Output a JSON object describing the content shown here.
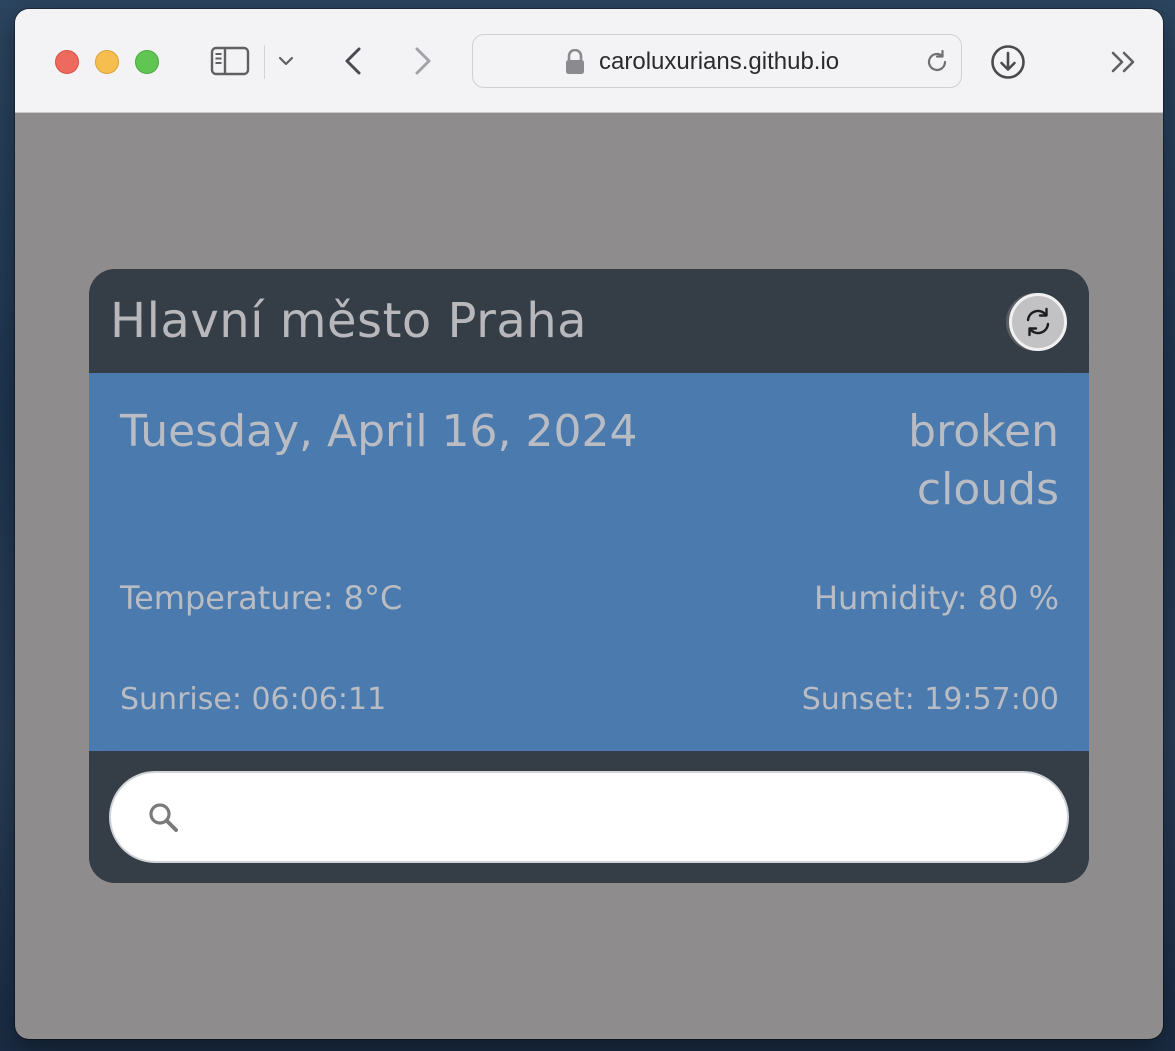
{
  "browser": {
    "url": "caroluxurians.github.io"
  },
  "weather": {
    "city": "Hlavní město Praha",
    "date": "Tuesday, April 16, 2024",
    "description": "broken clouds",
    "temperature": "Temperature: 8°C",
    "humidity": "Humidity: 80 %",
    "sunrise": "Sunrise: 06:06:11",
    "sunset": "Sunset: 19:57:00"
  },
  "search": {
    "value": "",
    "placeholder": ""
  },
  "colors": {
    "page_bg": "#8e8c8d",
    "card_dark": "#353d47",
    "card_body": "#4a7aae",
    "text": "#b9bcc3"
  },
  "icons": {
    "sidebar": "sidebar-icon",
    "refresh": "refresh-icon",
    "search": "search-icon",
    "download": "download-icon"
  }
}
